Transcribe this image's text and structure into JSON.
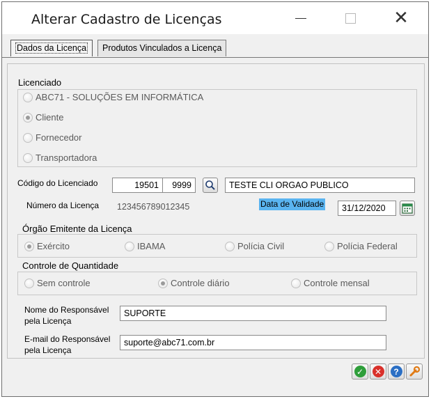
{
  "window": {
    "title": "Alterar Cadastro de Licenças",
    "controls": [
      "minimize",
      "maximize",
      "close"
    ]
  },
  "tabs": [
    {
      "label": "Dados da Licença",
      "active": true
    },
    {
      "label": "Produtos Vinculados a Licença",
      "active": false
    }
  ],
  "licenciado": {
    "group_label": "Licenciado",
    "options": [
      {
        "label": "ABC71 - SOLUÇÕES EM INFORMÁTICA",
        "checked": false
      },
      {
        "label": "Cliente",
        "checked": true
      },
      {
        "label": "Fornecedor",
        "checked": false
      },
      {
        "label": "Transportadora",
        "checked": false
      }
    ]
  },
  "codigo": {
    "label": "Código do Licenciado",
    "value1": "19501",
    "value2": "9999",
    "search_icon": "magnifier-icon",
    "name_value": "TESTE CLI ORGAO PUBLICO"
  },
  "numero": {
    "label": "Número da Licença",
    "value": "123456789012345"
  },
  "validade": {
    "label": "Data de Validade",
    "value": "31/12/2020",
    "calendar_icon": "calendar-icon",
    "highlight_color": "#5ab4f0"
  },
  "orgao": {
    "group_label": "Órgão Emitente da Licença",
    "options": [
      {
        "label": "Exército",
        "checked": true
      },
      {
        "label": "IBAMA",
        "checked": false
      },
      {
        "label": "Polícia Civil",
        "checked": false
      },
      {
        "label": "Polícia Federal",
        "checked": false
      }
    ]
  },
  "controle": {
    "group_label": "Controle de Quantidade",
    "options": [
      {
        "label": "Sem controle",
        "checked": false
      },
      {
        "label": "Controle diário",
        "checked": true
      },
      {
        "label": "Controle mensal",
        "checked": false
      }
    ]
  },
  "responsavel": {
    "label_line1": "Nome do Responsável",
    "label_line2": "pela Licença",
    "value": "SUPORTE"
  },
  "email": {
    "label_line1": "E-mail do Responsável",
    "label_line2": "pela Licença",
    "value": "suporte@abc71.com.br"
  },
  "actions": [
    {
      "icon": "ok-check-icon",
      "color": "#2e9e3a"
    },
    {
      "icon": "cancel-x-icon",
      "color": "#d9302a"
    },
    {
      "icon": "help-question-icon",
      "color": "#2b6fc4"
    },
    {
      "icon": "tools-wrench-icon",
      "color": "#e07a14"
    }
  ]
}
